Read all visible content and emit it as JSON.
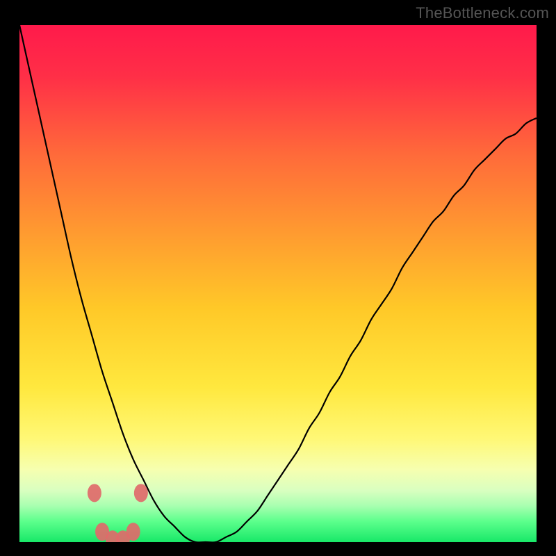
{
  "watermark": "TheBottleneck.com",
  "chart_data": {
    "type": "line",
    "title": "",
    "xlabel": "",
    "ylabel": "",
    "xlim": [
      0,
      100
    ],
    "ylim": [
      0,
      100
    ],
    "x": [
      0,
      2,
      4,
      6,
      8,
      10,
      12,
      14,
      16,
      18,
      20,
      22,
      24,
      26,
      28,
      30,
      32,
      34,
      36,
      38,
      40,
      42,
      44,
      46,
      48,
      50,
      52,
      54,
      56,
      58,
      60,
      62,
      64,
      66,
      68,
      70,
      72,
      74,
      76,
      78,
      80,
      82,
      84,
      86,
      88,
      90,
      92,
      94,
      96,
      98,
      100
    ],
    "values": [
      100,
      91,
      82,
      73,
      64,
      55,
      47,
      40,
      33,
      27,
      21,
      16,
      12,
      8,
      5,
      3,
      1,
      0,
      0,
      0,
      1,
      2,
      4,
      6,
      9,
      12,
      15,
      18,
      22,
      25,
      29,
      32,
      36,
      39,
      43,
      46,
      49,
      53,
      56,
      59,
      62,
      64,
      67,
      69,
      72,
      74,
      76,
      78,
      79,
      81,
      82
    ],
    "minimum_x": 18,
    "good_zone_y_threshold": 10,
    "markers": [
      {
        "x": 14.5,
        "y": 9.5
      },
      {
        "x": 16.0,
        "y": 2.0
      },
      {
        "x": 18.0,
        "y": 0.5
      },
      {
        "x": 20.0,
        "y": 0.5
      },
      {
        "x": 22.0,
        "y": 2.0
      },
      {
        "x": 23.5,
        "y": 9.5
      }
    ],
    "gradient_stops": [
      {
        "offset": 0.0,
        "color": "#ff1a4b"
      },
      {
        "offset": 0.1,
        "color": "#ff2f47"
      },
      {
        "offset": 0.25,
        "color": "#ff6a3a"
      },
      {
        "offset": 0.4,
        "color": "#ff9a30"
      },
      {
        "offset": 0.55,
        "color": "#ffc928"
      },
      {
        "offset": 0.7,
        "color": "#ffe83e"
      },
      {
        "offset": 0.8,
        "color": "#fff876"
      },
      {
        "offset": 0.86,
        "color": "#f6ffb0"
      },
      {
        "offset": 0.9,
        "color": "#d9ffc0"
      },
      {
        "offset": 0.93,
        "color": "#a8ffb0"
      },
      {
        "offset": 0.96,
        "color": "#5cff8c"
      },
      {
        "offset": 1.0,
        "color": "#18e868"
      }
    ]
  }
}
